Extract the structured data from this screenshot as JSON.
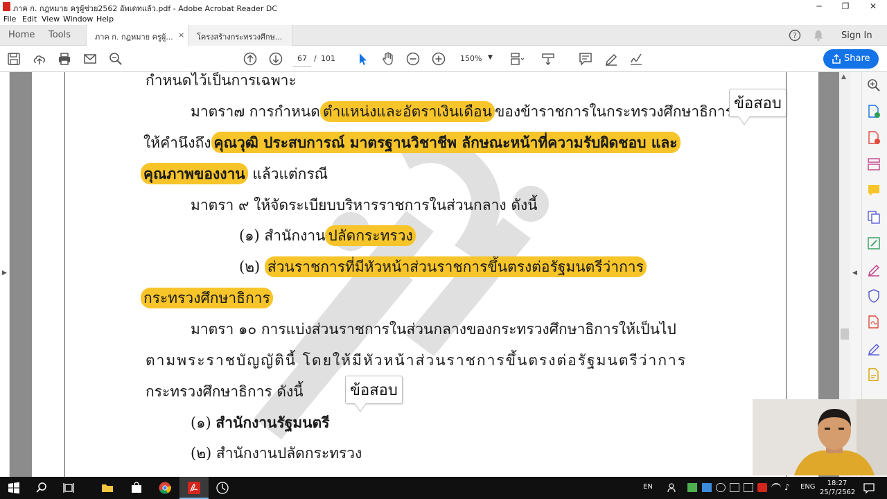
{
  "window": {
    "title": "ภาค ก. กฎหมาย ครูผู้ช่วย2562 อัพเดทแล้ว.pdf - Adobe Acrobat Reader DC",
    "minimize": "─",
    "maximize": "❐",
    "close": "✕"
  },
  "menu": {
    "items": [
      "File",
      "Edit",
      "View",
      "Window",
      "Help"
    ]
  },
  "tabs": {
    "home": "Home",
    "tools": "Tools",
    "doc_tab_1": "ภาค ก. กฎหมาย ครูผู้...",
    "doc_tab_close": "×",
    "doc_tab_2": "โครงสร้างกระทรวงศึกษ...",
    "sign_in": "Sign In"
  },
  "toolbar": {
    "current_page": "67",
    "page_separator": "/",
    "total_pages": "101",
    "zoom": "150%",
    "share_label": "Share"
  },
  "document": {
    "line1": "กำหนดไว้เป็นการเฉพาะ",
    "line2_a": "มาตรา๗ การกำหนด",
    "line2_hl": "ตำแหน่งและอัตราเงินเดือน",
    "line2_b": "ของข้าราชการในกระทรวงศึกษาธิการ",
    "line3_a": "ให้คำนึงถึง",
    "line3_hl": "คุณวุฒิ ประสบการณ์ มาตรฐานวิชาชีพ ลักษณะหน้าที่ความรับผิดชอบ และ",
    "line4_hl": "คุณภาพของงาน",
    "line4_b": " แล้วแต่กรณี",
    "line5": "มาตรา ๙ ให้จัดระเบียบบริหารราชการในส่วนกลาง ดังนี้",
    "line6_a": "(๑) สำนักงาน",
    "line6_hl": "ปลัดกระทรวง",
    "line7_a": "(๒) ",
    "line7_hl": "ส่วนราชการที่มีหัวหน้าส่วนราชการขึ้นตรงต่อรัฐมนตรีว่าการ",
    "line8_hl": "กระทรวงศึกษาธิการ",
    "line9": "มาตรา ๑๐ การแบ่งส่วนราชการในส่วนกลางของกระทรวงศึกษาธิการให้เป็นไป",
    "line10": "ตามพระราชบัญญัตินี้ โดยให้มีหัวหน้าส่วนราชการขึ้นตรงต่อรัฐมนตรีว่าการ",
    "line11": "กระทรวงศึกษาธิการ ดังนี้",
    "line12_a": "(๑) ",
    "line12_b": "สำนักงานรัฐมนตรี",
    "line13": "(๒) สำนักงานปลัดกระทรวง",
    "callout_1": "ข้อสอบ",
    "callout_2": "ข้อสอบ"
  },
  "taskbar": {
    "lang_en": "EN",
    "lang_eng": "ENG",
    "time": "18:27",
    "date": "25/7/2562"
  },
  "colors": {
    "highlight": "#f7c52a",
    "share_button": "#1473e6",
    "acrobat_red": "#d3261c",
    "tab_bar": "#eaeaea",
    "doc_gutter": "#8c8c8c",
    "taskbar": "#101010"
  },
  "icons": {
    "toolbar": [
      "save-icon",
      "upload-cloud-icon",
      "print-icon",
      "email-icon",
      "search-icon",
      "page-up-icon",
      "page-down-icon",
      "select-cursor-icon",
      "hand-icon",
      "zoom-out-icon",
      "zoom-in-icon",
      "page-layout-icon",
      "scroll-mode-icon",
      "comment-icon",
      "highlight-pen-icon",
      "sign-icon"
    ],
    "right_panel": [
      "zoom-tool-icon",
      "export-pdf-icon",
      "create-pdf-icon",
      "organize-pages-icon",
      "comment-tool-icon",
      "combine-files-icon",
      "edit-pdf-icon",
      "fill-sign-icon",
      "protect-icon",
      "pdf-icon",
      "sign-pen-icon",
      "send-for-signature-icon"
    ]
  }
}
